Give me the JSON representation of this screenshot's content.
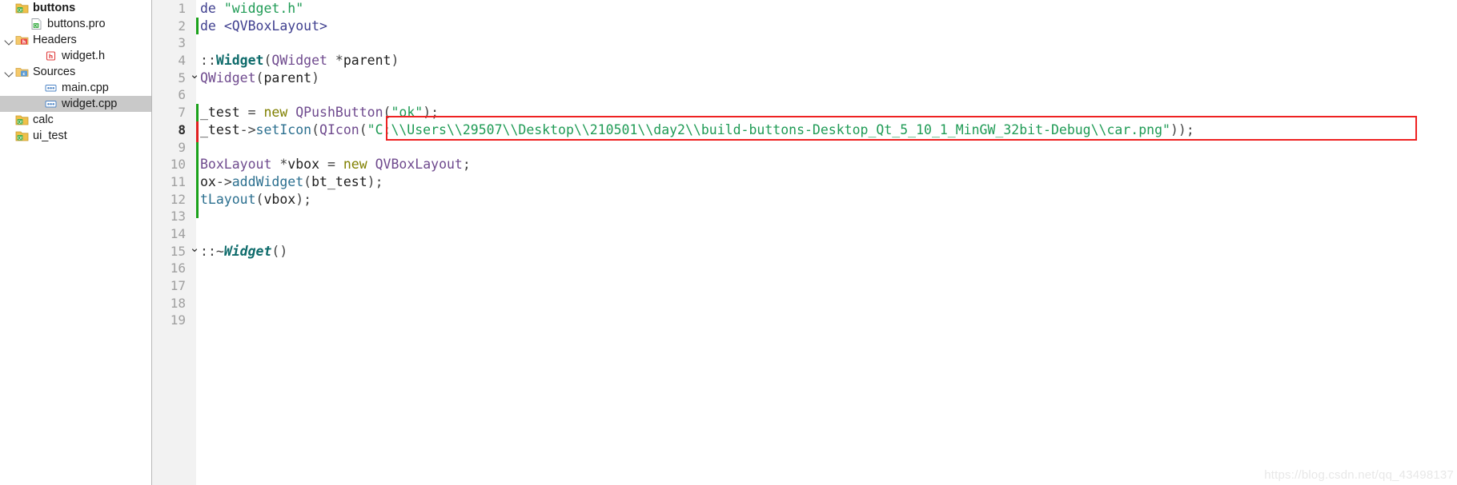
{
  "sidebar": {
    "items": [
      {
        "label": "buttons",
        "icon": "qt-project-icon",
        "indent": 0,
        "arrow": "none",
        "bold": true,
        "selected": false
      },
      {
        "label": "buttons.pro",
        "icon": "pro-file-icon",
        "indent": 1,
        "arrow": "none",
        "bold": false,
        "selected": false
      },
      {
        "label": "Headers",
        "icon": "headers-folder-icon",
        "indent": 0,
        "arrow": "open",
        "bold": false,
        "selected": false
      },
      {
        "label": "widget.h",
        "icon": "h-file-icon",
        "indent": 2,
        "arrow": "none",
        "bold": false,
        "selected": false
      },
      {
        "label": "Sources",
        "icon": "sources-folder-icon",
        "indent": 0,
        "arrow": "open",
        "bold": false,
        "selected": false
      },
      {
        "label": "main.cpp",
        "icon": "cpp-file-icon",
        "indent": 2,
        "arrow": "none",
        "bold": false,
        "selected": false
      },
      {
        "label": "widget.cpp",
        "icon": "cpp-file-icon",
        "indent": 2,
        "arrow": "none",
        "bold": false,
        "selected": true
      },
      {
        "label": "calc",
        "icon": "qt-project-icon",
        "indent": 0,
        "arrow": "none",
        "bold": false,
        "selected": false
      },
      {
        "label": "ui_test",
        "icon": "qt-project-icon",
        "indent": 0,
        "arrow": "none",
        "bold": false,
        "selected": false
      }
    ]
  },
  "editor": {
    "current_line": 8,
    "caret_line": 2,
    "lines": [
      {
        "n": "1",
        "fold": "",
        "text": "de \"widget.h\""
      },
      {
        "n": "2",
        "fold": "",
        "text": "de <QVBoxLayout>"
      },
      {
        "n": "3",
        "fold": "",
        "text": ""
      },
      {
        "n": "4",
        "fold": "",
        "text": "::Widget(QWidget *parent)"
      },
      {
        "n": "5",
        "fold": "v",
        "text": "QWidget(parent)"
      },
      {
        "n": "6",
        "fold": "",
        "text": ""
      },
      {
        "n": "7",
        "fold": "",
        "text": "_test = new QPushButton(\"ok\");"
      },
      {
        "n": "8",
        "fold": "",
        "text": "_test->setIcon(QIcon(\"C:\\\\Users\\\\29507\\\\Desktop\\\\210501\\\\day2\\\\build-buttons-Desktop_Qt_5_10_1_MinGW_32bit-Debug\\\\car.png\"));"
      },
      {
        "n": "9",
        "fold": "",
        "text": ""
      },
      {
        "n": "10",
        "fold": "",
        "text": "BoxLayout *vbox = new QVBoxLayout;"
      },
      {
        "n": "11",
        "fold": "",
        "text": "ox->addWidget(bt_test);"
      },
      {
        "n": "12",
        "fold": "",
        "text": "tLayout(vbox);"
      },
      {
        "n": "13",
        "fold": "",
        "text": ""
      },
      {
        "n": "14",
        "fold": "",
        "text": ""
      },
      {
        "n": "15",
        "fold": "v",
        "text": "::~Widget()"
      },
      {
        "n": "16",
        "fold": "",
        "text": ""
      },
      {
        "n": "17",
        "fold": "",
        "text": ""
      },
      {
        "n": "18",
        "fold": "",
        "text": ""
      },
      {
        "n": "19",
        "fold": "",
        "text": ""
      }
    ],
    "highlighted_path": "C:\\\\Users\\\\29507\\\\Desktop\\\\210501\\\\day2\\\\build-buttons-Desktop_Qt_5_10_1_MinGW_32bit-Debug\\\\car.png",
    "colors": {
      "string": "#1f9b55",
      "keyword": "#808000",
      "type": "#6f4a8e",
      "class": "#0e6b6b",
      "line_number": "#a0a0a0",
      "gutter_bg": "#f2f2f2",
      "change_added": "#1aa11a",
      "change_modified": "#e02020",
      "annotation_box": "#ee2222",
      "selection_bg": "#c9c9c9"
    }
  },
  "watermark": {
    "text": "https://blog.csdn.net/qq_43498137"
  }
}
